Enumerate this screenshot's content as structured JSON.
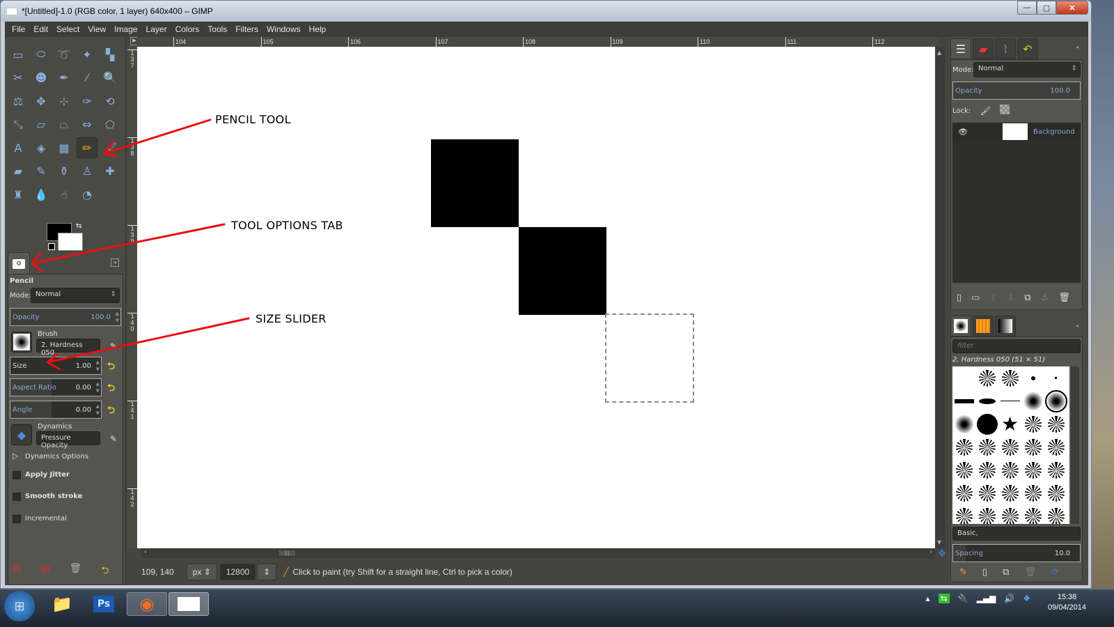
{
  "window": {
    "title": "*[Untitled]-1.0 (RGB color, 1 layer) 640x400 – GIMP",
    "minimize": "—",
    "maximize": "▢",
    "close": "✕"
  },
  "menu": [
    "File",
    "Edit",
    "Select",
    "View",
    "Image",
    "Layer",
    "Colors",
    "Tools",
    "Filters",
    "Windows",
    "Help"
  ],
  "toolbox": {
    "tools": [
      {
        "name": "rect-select-icon",
        "glyph": "▭"
      },
      {
        "name": "ellipse-select-icon",
        "glyph": "⬭"
      },
      {
        "name": "free-select-icon",
        "glyph": "➰"
      },
      {
        "name": "fuzzy-select-icon",
        "glyph": "✦"
      },
      {
        "name": "select-by-color-icon",
        "glyph": "▚"
      },
      {
        "name": "scissors-select-icon",
        "glyph": "✂"
      },
      {
        "name": "foreground-select-icon",
        "glyph": "☻"
      },
      {
        "name": "paths-icon",
        "glyph": "✒"
      },
      {
        "name": "color-picker-icon",
        "glyph": "⁄"
      },
      {
        "name": "zoom-icon",
        "glyph": "🔍"
      },
      {
        "name": "measure-icon",
        "glyph": "⚖"
      },
      {
        "name": "move-icon",
        "glyph": "✥"
      },
      {
        "name": "align-icon",
        "glyph": "⊹"
      },
      {
        "name": "crop-icon",
        "glyph": "✑"
      },
      {
        "name": "rotate-icon",
        "glyph": "⟲"
      },
      {
        "name": "scale-icon",
        "glyph": "⤡"
      },
      {
        "name": "shear-icon",
        "glyph": "▱"
      },
      {
        "name": "perspective-icon",
        "glyph": "⏢"
      },
      {
        "name": "flip-icon",
        "glyph": "⇔"
      },
      {
        "name": "cage-transform-icon",
        "glyph": "⬠"
      },
      {
        "name": "text-icon",
        "glyph": "A"
      },
      {
        "name": "bucket-fill-icon",
        "glyph": "◈"
      },
      {
        "name": "blend-icon",
        "glyph": "▦"
      },
      {
        "name": "pencil-icon",
        "glyph": "✏",
        "active": true
      },
      {
        "name": "paintbrush-icon",
        "glyph": "🖌"
      },
      {
        "name": "eraser-icon",
        "glyph": "▰"
      },
      {
        "name": "airbrush-icon",
        "glyph": "✎"
      },
      {
        "name": "ink-icon",
        "glyph": "⚱"
      },
      {
        "name": "clone-icon",
        "glyph": "♙"
      },
      {
        "name": "heal-icon",
        "glyph": "✚"
      },
      {
        "name": "perspective-clone-icon",
        "glyph": "♜"
      },
      {
        "name": "blur-icon",
        "glyph": "💧"
      },
      {
        "name": "smudge-icon",
        "glyph": "☝"
      },
      {
        "name": "dodge-burn-icon",
        "glyph": "◔"
      }
    ],
    "swap_glyph": "⇆"
  },
  "tool_options": {
    "tool_name": "Pencil",
    "mode_label": "Mode:",
    "mode_value": "Normal",
    "opacity": {
      "label": "Opacity",
      "value": "100.0",
      "fraction": 1.0
    },
    "brush_label": "Brush",
    "brush_value": "2. Hardness 050",
    "size": {
      "label": "Size",
      "value": "1.00",
      "fraction": 0.0
    },
    "aspect": {
      "label": "Aspect Ratio",
      "value": "0.00",
      "fraction": 0.5
    },
    "angle": {
      "label": "Angle",
      "value": "0.00",
      "fraction": 0.5
    },
    "dynamics_label": "Dynamics",
    "dynamics_value": "Pressure Opacity",
    "dynamics_options": "Dynamics Options",
    "apply_jitter": "Apply Jitter",
    "smooth_stroke": "Smooth stroke",
    "incremental": "Incremental"
  },
  "rulers": {
    "h": [
      "104",
      "105",
      "106",
      "107",
      "108",
      "109",
      "110",
      "111",
      "112"
    ],
    "v": [
      "137",
      "138",
      "139",
      "140",
      "141",
      "142"
    ]
  },
  "annotations": {
    "pencil": "PENCIL TOOL",
    "tool_options": "TOOL OPTIONS TAB",
    "size": "SIZE SLIDER",
    "arrow_color": "#e81010"
  },
  "status": {
    "coords": "109, 140",
    "unit": "px",
    "zoom": "12800",
    "message": "Click to paint (try Shift for a straight line, Ctrl to pick a color)"
  },
  "layers": {
    "mode_label": "Mode:",
    "mode_value": "Normal",
    "opacity_label": "Opacity",
    "opacity_value": "100.0",
    "lock_label": "Lock:",
    "layer_name": "Background"
  },
  "brushes": {
    "filter_placeholder": "filter",
    "current": "2. Hardness 050 (51 × 51)",
    "tag": "Basic,",
    "spacing_label": "Spacing",
    "spacing_value": "10.0"
  },
  "taskbar": {
    "time": "15:38",
    "date": "09/04/2014",
    "ps_label": "Ps"
  }
}
